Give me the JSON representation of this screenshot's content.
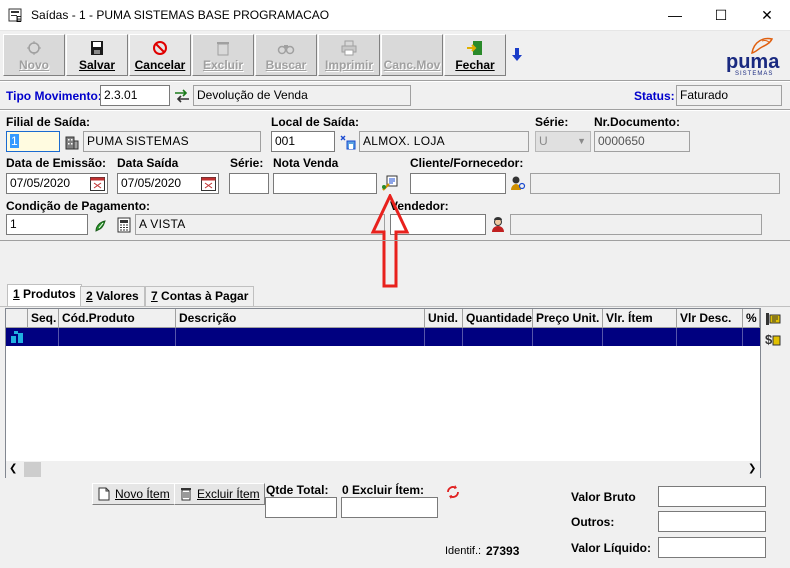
{
  "window": {
    "title": "Saídas - 1 - PUMA SISTEMAS  BASE PROGRAMACAO",
    "minimize": "—",
    "maximize": "☐",
    "close": "✕"
  },
  "toolbar": {
    "novo": "Novo",
    "salvar": "Salvar",
    "cancelar": "Cancelar",
    "excluir": "Excluir",
    "buscar": "Buscar",
    "imprimir": "Imprimir",
    "canc_mov": "Canc.Mov",
    "fechar": "Fechar"
  },
  "logo": {
    "text": "puma",
    "sub": "SISTEMAS"
  },
  "header": {
    "tipo_label": "Tipo Movimento:",
    "tipo_code": "2.3.01",
    "tipo_desc": "Devolução de Venda",
    "status_label": "Status:",
    "status_value": "Faturado"
  },
  "form": {
    "filial_label": "Filial de Saída:",
    "filial_code": "1",
    "filial_name": "PUMA SISTEMAS",
    "local_label": "Local de Saída:",
    "local_code": "001",
    "local_name": "ALMOX. LOJA",
    "serie_label": "Série:",
    "serie_value": "U",
    "nr_doc_label": "Nr.Documento:",
    "nr_doc_value": "0000650",
    "data_emissao_label": "Data de Emissão:",
    "data_emissao_value": "07/05/2020",
    "data_saida_label": "Data Saída",
    "data_saida_value": "07/05/2020",
    "serie2_label": "Série:",
    "serie2_value": "",
    "nota_venda_label": "Nota Venda",
    "nota_venda_value": "",
    "cliente_label": "Cliente/Fornecedor:",
    "cliente_code": "",
    "cliente_name": "",
    "cond_pag_label": "Condição de Pagamento:",
    "cond_pag_code": "1",
    "cond_pag_name": "A VISTA",
    "vendedor_label": "Vendedor:",
    "vendedor_code": "",
    "vendedor_name": ""
  },
  "tabs": [
    {
      "key": "1",
      "label": " Produtos"
    },
    {
      "key": "2",
      "label": " Valores"
    },
    {
      "key": "7",
      "label": " Contas à Pagar"
    }
  ],
  "grid": {
    "columns": [
      "Seq.",
      "Cód.Produto",
      "Descrição",
      "Unid.",
      "Quantidade",
      "Preço Unit.",
      "Vlr. Ítem",
      "Vlr Desc.",
      "%"
    ]
  },
  "bottom": {
    "novo_item": "Novo Ítem",
    "excluir_item": "Excluir Ítem",
    "qtde_total_label": "Qtde Total:",
    "qtde_total_value": "",
    "excluir_item_label": "0 Excluir Ítem:",
    "excluir_item_value": "",
    "valor_bruto_label": "Valor Bruto",
    "valor_bruto_value": "",
    "outros_label": "Outros:",
    "outros_value": "",
    "valor_liquido_label": "Valor Líquido:",
    "valor_liquido_value": "",
    "identif_label": "Identif.:",
    "identif_value": "27393"
  },
  "colors": {
    "accent_blue": "#000080",
    "status_label": "#0000cc",
    "annotation_arrow": "#e8211d",
    "filial_input": "#fffbe0"
  }
}
